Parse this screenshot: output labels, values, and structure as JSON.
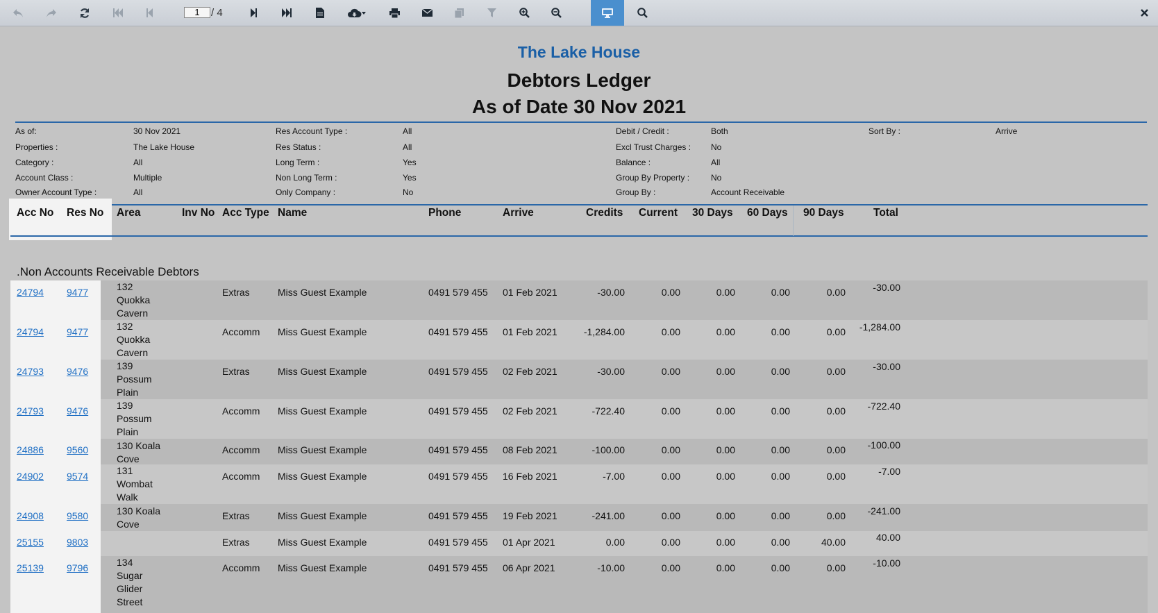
{
  "toolbar": {
    "page_current": "1",
    "page_total": "/ 4",
    "buttons": [
      "undo-icon",
      "redo-icon",
      "refresh-icon",
      "first-page-icon",
      "prev-page-icon",
      "next-page-icon",
      "last-page-icon",
      "document-icon",
      "download-icon",
      "print-icon",
      "email-icon",
      "copy-icon",
      "filter-icon",
      "zoom-in-icon",
      "zoom-out-icon",
      "display-icon",
      "search-icon",
      "close-icon"
    ]
  },
  "report": {
    "company": "The Lake House",
    "title": "Debtors Ledger",
    "subtitle": "As of Date 30 Nov 2021",
    "params": [
      {
        "label": "As of:",
        "value": "30 Nov 2021"
      },
      {
        "label": "Properties :",
        "value": "The Lake House"
      },
      {
        "label": "Category :",
        "value": "All"
      },
      {
        "label": "Account Class :",
        "value": "Multiple"
      },
      {
        "label": "Owner Account Type :",
        "value": "All"
      },
      {
        "label": "Res Account Type :",
        "value": "All"
      },
      {
        "label": "Res Status :",
        "value": "All"
      },
      {
        "label": "Long Term :",
        "value": "Yes"
      },
      {
        "label": "Non Long Term :",
        "value": "Yes"
      },
      {
        "label": "Only Company :",
        "value": "No"
      },
      {
        "label": "Debit / Credit :",
        "value": "Both"
      },
      {
        "label": "Excl Trust Charges :",
        "value": "No"
      },
      {
        "label": "Balance :",
        "value": "All"
      },
      {
        "label": "Group By Property :",
        "value": "No"
      },
      {
        "label": "Group By :",
        "value": "Account Receivable"
      },
      {
        "label": "Sort By :",
        "value": "Arrive"
      }
    ],
    "columns": [
      "Acc No",
      "Res No",
      "Area",
      "Inv No",
      "Acc Type",
      "Name",
      "Phone",
      "Arrive",
      "Credits",
      "Current",
      "30 Days",
      "60 Days",
      "90 Days",
      "Total"
    ],
    "group_title": ".Non Accounts Receivable Debtors",
    "rows": [
      {
        "acc": "24794",
        "res": "9477",
        "area": [
          "132",
          "Quokka",
          "Cavern"
        ],
        "type": "Extras",
        "name": "Miss Guest Example",
        "phone": "0491 579 455",
        "arrive": "01 Feb 2021",
        "credits": "-30.00",
        "current": "0.00",
        "d30": "0.00",
        "d60": "0.00",
        "d90": "0.00",
        "total": "-30.00"
      },
      {
        "acc": "24794",
        "res": "9477",
        "area": [
          "132",
          "Quokka",
          "Cavern"
        ],
        "type": "Accomm",
        "name": "Miss Guest Example",
        "phone": "0491 579 455",
        "arrive": "01 Feb 2021",
        "credits": "-1,284.00",
        "current": "0.00",
        "d30": "0.00",
        "d60": "0.00",
        "d90": "0.00",
        "total": "-1,284.00"
      },
      {
        "acc": "24793",
        "res": "9476",
        "area": [
          "139",
          "Possum",
          "Plain"
        ],
        "type": "Extras",
        "name": "Miss Guest Example",
        "phone": "0491 579 455",
        "arrive": "02 Feb 2021",
        "credits": "-30.00",
        "current": "0.00",
        "d30": "0.00",
        "d60": "0.00",
        "d90": "0.00",
        "total": "-30.00"
      },
      {
        "acc": "24793",
        "res": "9476",
        "area": [
          "139",
          "Possum",
          "Plain"
        ],
        "type": "Accomm",
        "name": "Miss Guest Example",
        "phone": "0491 579 455",
        "arrive": "02 Feb 2021",
        "credits": "-722.40",
        "current": "0.00",
        "d30": "0.00",
        "d60": "0.00",
        "d90": "0.00",
        "total": "-722.40"
      },
      {
        "acc": "24886",
        "res": "9560",
        "area": [
          "130 Koala",
          "Cove"
        ],
        "type": "Accomm",
        "name": "Miss Guest Example",
        "phone": "0491 579 455",
        "arrive": "08 Feb 2021",
        "credits": "-100.00",
        "current": "0.00",
        "d30": "0.00",
        "d60": "0.00",
        "d90": "0.00",
        "total": "-100.00"
      },
      {
        "acc": "24902",
        "res": "9574",
        "area": [
          "131",
          "Wombat",
          "Walk"
        ],
        "type": "Accomm",
        "name": "Miss Guest Example",
        "phone": "0491 579 455",
        "arrive": "16 Feb 2021",
        "credits": "-7.00",
        "current": "0.00",
        "d30": "0.00",
        "d60": "0.00",
        "d90": "0.00",
        "total": "-7.00"
      },
      {
        "acc": "24908",
        "res": "9580",
        "area": [
          "130 Koala",
          "Cove"
        ],
        "type": "Extras",
        "name": "Miss Guest Example",
        "phone": "0491 579 455",
        "arrive": "19 Feb 2021",
        "credits": "-241.00",
        "current": "0.00",
        "d30": "0.00",
        "d60": "0.00",
        "d90": "0.00",
        "total": "-241.00"
      },
      {
        "acc": "25155",
        "res": "9803",
        "area": [],
        "type": "Extras",
        "name": "Miss Guest Example",
        "phone": "0491 579 455",
        "arrive": "01 Apr 2021",
        "credits": "0.00",
        "current": "0.00",
        "d30": "0.00",
        "d60": "0.00",
        "d90": "40.00",
        "total": "40.00"
      },
      {
        "acc": "25139",
        "res": "9796",
        "area": [
          "134",
          "Sugar",
          "Glider",
          "Street"
        ],
        "type": "Accomm",
        "name": "Miss Guest Example",
        "phone": "0491 579 455",
        "arrive": "06 Apr 2021",
        "credits": "-10.00",
        "current": "0.00",
        "d30": "0.00",
        "d60": "0.00",
        "d90": "0.00",
        "total": "-10.00"
      }
    ]
  }
}
